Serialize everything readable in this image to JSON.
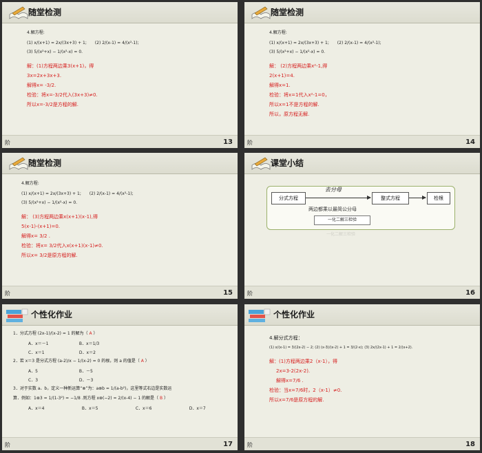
{
  "footer_glyph": "阶",
  "slides": {
    "s13": {
      "title": "随堂检测",
      "page": "13",
      "question": "4.解方程:",
      "eq1": "(1) x/(x+1) = 2x/(3x+3) + 1;",
      "eq2": "(2) 2/(x-1) = 4/(x²-1);",
      "eq3": "(3) 5/(x²+x) − 1/(x²-x) = 0.",
      "answer": [
        "解：(1)方程两边乘3(x+1)，得",
        "3x=2x+3x+3.",
        "解得x= -3/2.",
        "检验：将x=-3/2代入(3x+3)≠0.",
        "所以x=-3/2是方程的解."
      ]
    },
    "s14": {
      "title": "随堂检测",
      "page": "14",
      "question": "4.解方程:",
      "eq1": "(1) x/(x+1) = 2x/(3x+3) + 1;",
      "eq2": "(2) 2/(x-1) = 4/(x²-1);",
      "eq3": "(3) 5/(x²+x) − 1/(x²-x) = 0.",
      "answer": [
        "解： (2)方程两边乘x²-1,得",
        "2(x+1)=4.",
        "解得x=1.",
        "检验：将x=1代入x²-1=0，",
        "所以x=1不是方程的解.",
        "所以，原方程无解."
      ]
    },
    "s15": {
      "title": "随堂检测",
      "page": "15",
      "question": "4.解方程:",
      "eq1": "(1) x/(x+1) = 2x/(3x+3) + 1;",
      "eq2": "(2) 2/(x-1) = 4/(x²-1);",
      "eq3": "(3) 5/(x²+x) − 1/(x²-x) = 0.",
      "answer": [
        "解： (3)方程两边乘x(x+1)(x-1),得",
        "5(x-1)-(x+1)=0.",
        "解得x= 3/2 .",
        "检验：将x= 3/2代入x(x+1)(x-1)≠0.",
        "所以x= 3/2是原方程的解."
      ]
    },
    "s16": {
      "title": "课堂小结",
      "page": "16",
      "node1": "分式方程",
      "node2": "整式方程",
      "node3": "检根",
      "step_top": "去分母",
      "step_bottom": "两边都乘以最简公分母",
      "summary": "一化二解三检验",
      "reflection": "一化二解三检验"
    },
    "s17": {
      "title": "个性化作业",
      "page": "17",
      "q1": "1．分式方程 (2x-1)/(x-2) = 1 的解为（",
      "q1_ans": "A",
      "q1_end": "）",
      "q1_opts": [
        "A．x＝－1",
        "B．x＝1/3",
        "C．x＝1",
        "D．x＝2"
      ],
      "q2": "2．若 x＝3 是分式方程 (a-2)/x − 1/(x-2) = 0 的根，则 a 的值是（",
      "q2_ans": "A",
      "q2_end": "）",
      "q2_opts": [
        "A．5",
        "B．－5",
        "C．3",
        "D．－3"
      ],
      "q3a": "3．对于实数 a、b，定义一种新运算“⊗”为：a⊗b = 1/(a-b²)，这里等式右边是实数运",
      "q3b": "算．例如：1⊗3 = 1/(1-3²) = −1/8 .则方程 x⊗(−2) = 2/(x-4) − 1 的解是（",
      "q3_ans": "B",
      "q3_end": "）",
      "q3_opts": [
        "A．x＝4",
        "B．x＝5",
        "C．x＝6",
        "D．x＝7"
      ]
    },
    "s18": {
      "title": "个性化作业",
      "page": "18",
      "question": "4.解分式方程：",
      "eqs": "(1) x/(x-1) = 3/(2x-2) − 2;  (2) (x-3)/(x-2) + 1 = 3/(2-x);  (3) 2x/(2x-1) + 1 = 2/(x+2).",
      "answer": [
        "解：(1)方程两边乘2（x-1），得",
        "2x=3-2(2x-2).",
        "解得x=7/6 .",
        "检验：当x=7/6时，2（x-1）≠0.",
        "所以x=7/6是原方程的解."
      ]
    }
  }
}
